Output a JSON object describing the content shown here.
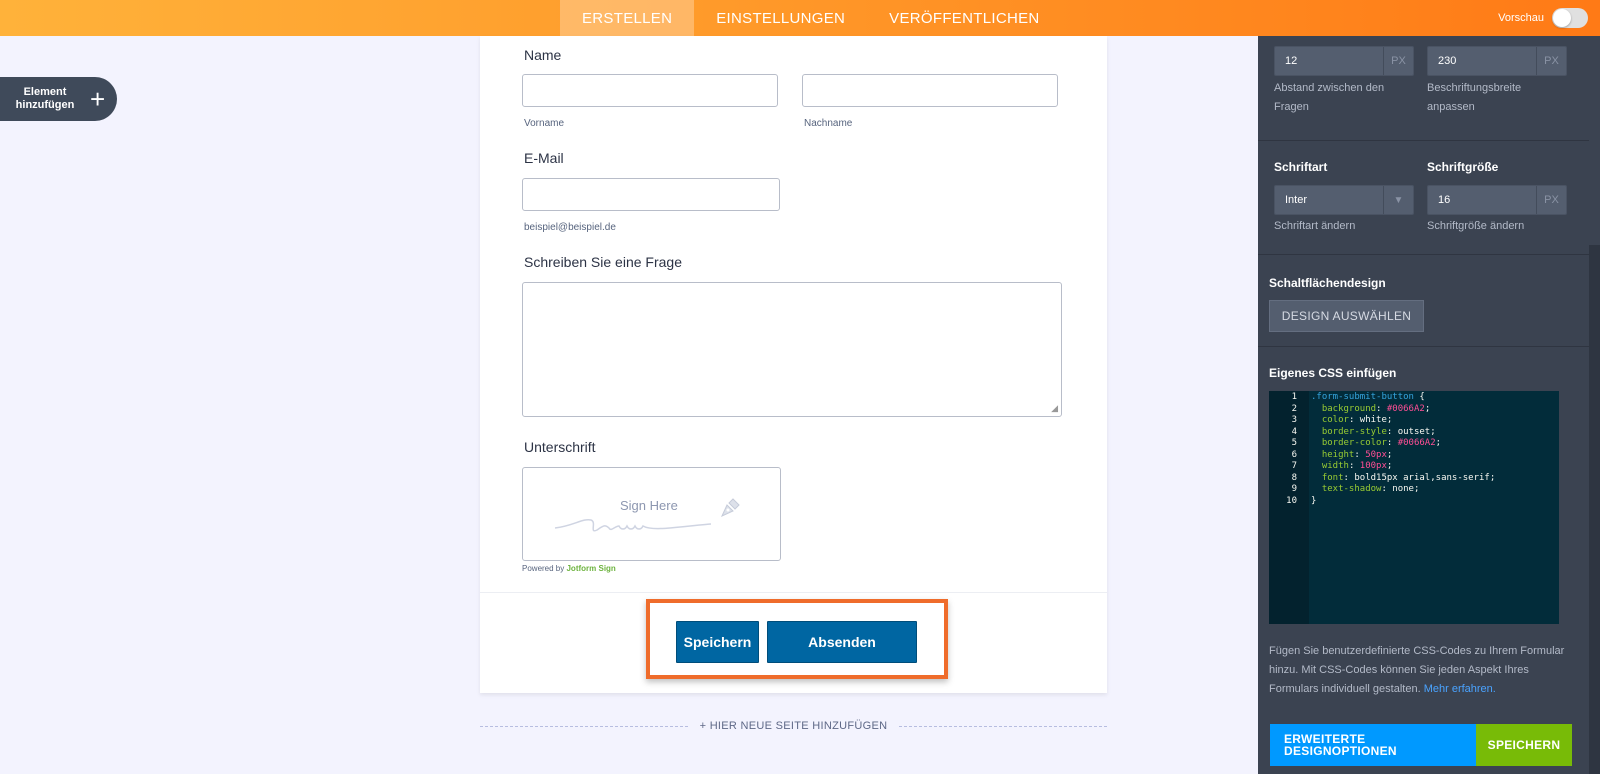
{
  "topbar": {
    "tabs": [
      {
        "label": "ERSTELLEN",
        "active": true
      },
      {
        "label": "EINSTELLUNGEN",
        "active": false
      },
      {
        "label": "VERÖFFENTLICHEN",
        "active": false
      }
    ],
    "preview_label": "Vorschau",
    "preview_on": false
  },
  "add_element": {
    "label": "Element hinzufügen",
    "icon": "plus-icon"
  },
  "form": {
    "name_label": "Name",
    "first_sublabel": "Vorname",
    "last_sublabel": "Nachname",
    "email_label": "E-Mail",
    "email_sublabel": "beispiel@beispiel.de",
    "question_label": "Schreiben Sie eine Frage",
    "signature_label": "Unterschrift",
    "signature_placeholder": "Sign Here",
    "powered_prefix": "Powered by",
    "powered_brand": "Jotform Sign",
    "save_button": "Speichern",
    "submit_button": "Absenden",
    "highlight_color": "#ef6c2b",
    "button_color": "#0066A2"
  },
  "add_page": "+ HIER NEUE SEITE HINZUFÜGEN",
  "panel": {
    "spacing_value": "12",
    "spacing_unit": "PX",
    "spacing_label": "Abstand zwischen den Fragen",
    "label_width_value": "230",
    "label_width_unit": "PX",
    "label_width_label": "Beschriftungsbreite anpassen",
    "font_heading": "Schriftart",
    "font_value": "Inter",
    "font_label": "Schriftart ändern",
    "size_heading": "Schriftgröße",
    "size_value": "16",
    "size_unit": "PX",
    "size_label": "Schriftgröße ändern",
    "button_design_heading": "Schaltflächendesign",
    "design_button": "DESIGN AUSWÄHLEN",
    "css_heading": "Eigenes CSS einfügen",
    "css_lines": [
      {
        "n": "1",
        "text": ".form-submit-button {"
      },
      {
        "n": "2",
        "text": "  background: #0066A2;"
      },
      {
        "n": "3",
        "text": "  color: white;"
      },
      {
        "n": "4",
        "text": "  border-style: outset;"
      },
      {
        "n": "5",
        "text": "  border-color: #0066A2;"
      },
      {
        "n": "6",
        "text": "  height: 50px;"
      },
      {
        "n": "7",
        "text": "  width: 100px;"
      },
      {
        "n": "8",
        "text": "  font: bold15px arial,sans-serif;"
      },
      {
        "n": "9",
        "text": "  text-shadow: none;"
      },
      {
        "n": "10",
        "text": "}"
      }
    ],
    "help_text": "Fügen Sie benutzerdefinierte CSS-Codes zu Ihrem Formular hinzu. Mit CSS-Codes können Sie jeden Aspekt Ihres Formulars individuell gestalten.",
    "help_link": "Mehr erfahren.",
    "advanced_button": "ERWEITERTE DESIGNOPTIONEN",
    "save_button": "SPEICHERN"
  }
}
